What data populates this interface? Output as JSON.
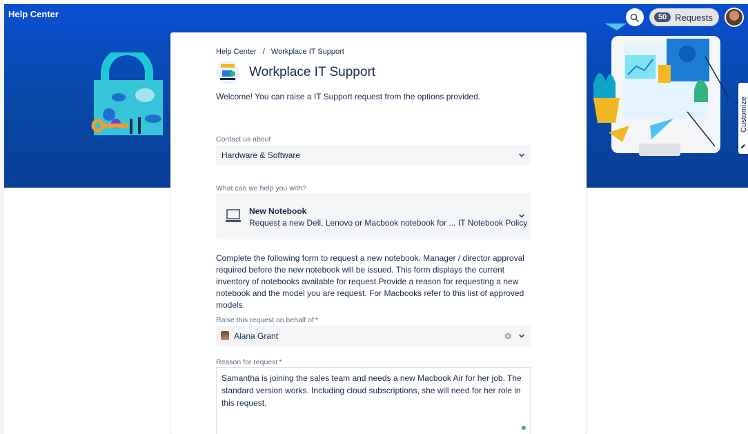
{
  "app": {
    "title": "Help Center"
  },
  "header": {
    "requests_count": "50",
    "requests_label": "Requests"
  },
  "breadcrumb": {
    "root": "Help Center",
    "separator": "/",
    "current": "Workplace IT Support"
  },
  "portal": {
    "title": "Workplace IT Support",
    "welcome": "Welcome! You can raise a IT Support request from the options provided."
  },
  "contact": {
    "label": "Contact us about",
    "value": "Hardware & Software"
  },
  "help": {
    "label": "What can we help you with?",
    "type_title": "New Notebook",
    "type_desc": "Request a new Dell, Lenovo or Macbook notebook for ... IT Notebook Policy"
  },
  "description": "Complete the following form to request a new notebook. Manager / director approval required before the new notebook will be issued. This form displays the current inventory of notebooks available for request.Provide a reason for requesting a new notebook and the model you are request. For Macbooks refer to this list of approved models.",
  "behalf": {
    "label": "Raise this request on behalf of",
    "required_mark": "*",
    "value": "Alana Grant"
  },
  "reason": {
    "label": "Reason for request",
    "required_mark": "*",
    "value": "Samantha is joining the sales team and needs a new Macbook Air for her job.  The standard version works.  Including cloud subscriptions, she will need for her role in this request."
  },
  "sidebar": {
    "customize_label": "Customize"
  },
  "icons": {
    "search": "search-icon",
    "chevron": "chevron-down-icon",
    "clear": "clear-icon",
    "laptop": "laptop-icon",
    "edit": "pencil-icon"
  },
  "colors": {
    "hero": "#0747A6",
    "required": "#DE350B",
    "field_bg": "#F4F5F7"
  }
}
